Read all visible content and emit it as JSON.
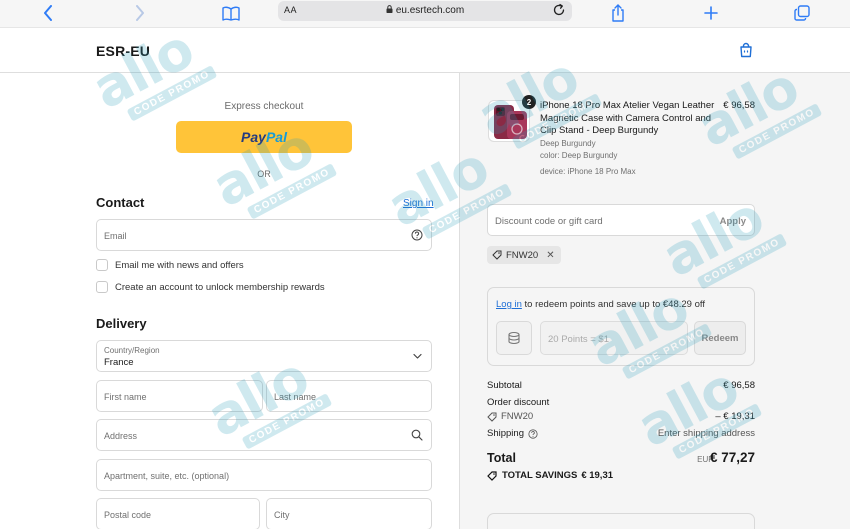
{
  "browser": {
    "text_size_label": "AA",
    "url": "eu.esrtech.com"
  },
  "store": {
    "brand": "ESR-EU"
  },
  "checkout": {
    "express_label": "Express checkout",
    "paypal_pay": "Pay",
    "paypal_pal": "Pal",
    "or_label": "OR",
    "contact_title": "Contact",
    "sign_in": "Sign in",
    "email_placeholder": "Email",
    "news_checkbox": "Email me with news and offers",
    "account_checkbox": "Create an account to unlock membership rewards",
    "delivery_title": "Delivery",
    "country_label": "Country/Region",
    "country_value": "France",
    "first_name_placeholder": "First name",
    "last_name_placeholder": "Last name",
    "address_placeholder": "Address",
    "apartment_placeholder": "Apartment, suite, etc. (optional)",
    "postal_placeholder": "Postal code",
    "city_placeholder": "City"
  },
  "summary": {
    "product": {
      "quantity": "2",
      "title": "iPhone 18 Pro Max Atelier Vegan Leather Magnetic Case with Camera Control and Clip Stand - Deep Burgundy",
      "price": "€ 96,58",
      "variant": "Deep Burgundy",
      "color": "color: Deep Burgundy",
      "device": "device: iPhone 18 Pro Max"
    },
    "discount_placeholder": "Discount code or gift card",
    "apply_label": "Apply",
    "applied_code": "FNW20",
    "points": {
      "login_link": "Log in",
      "message": " to redeem points and save up to €48.29 off",
      "input_placeholder": "20 Points = $1",
      "redeem_label": "Redeem"
    },
    "subtotal_label": "Subtotal",
    "subtotal_value": "€ 96,58",
    "order_discount_label": "Order discount",
    "discount_code": "FNW20",
    "discount_value": "– € 19,31",
    "shipping_label": "Shipping",
    "shipping_value": "Enter shipping address",
    "total_label": "Total",
    "total_currency": "EUR",
    "total_value": "€ 77,27",
    "savings_label": "TOTAL SAVINGS",
    "savings_value": "€ 19,31"
  },
  "watermark": {
    "main": "allo",
    "sub": "CODE PROMO"
  },
  "colors": {
    "link": "#1f6fd6",
    "paypal_yellow": "#ffc439",
    "paypal_dark_blue": "#253b80",
    "paypal_light_blue": "#179bd7",
    "browser_accent": "#2f7cf6",
    "watermark": "#2a9dbb",
    "product_burgundy": "#7a1f3a"
  }
}
